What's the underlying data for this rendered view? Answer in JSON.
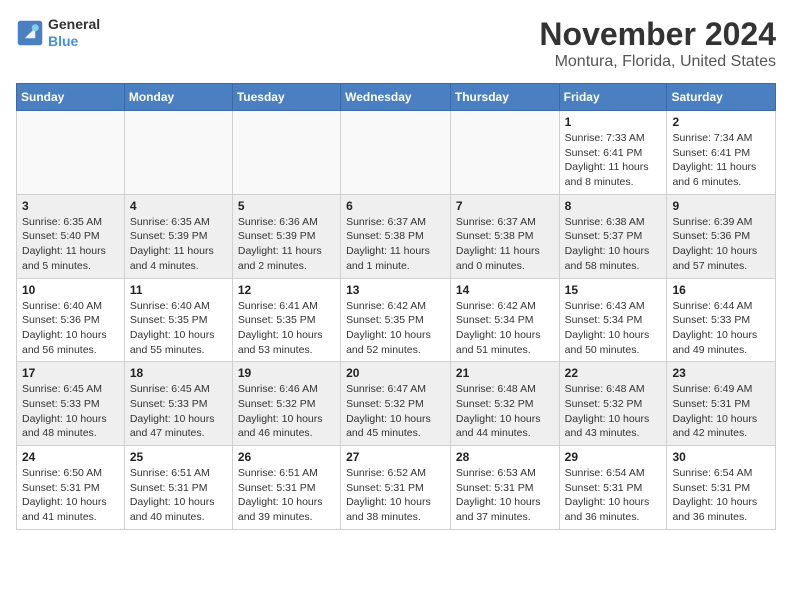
{
  "app": {
    "logo_line1": "General",
    "logo_line2": "Blue"
  },
  "title": "November 2024",
  "subtitle": "Montura, Florida, United States",
  "weekdays": [
    "Sunday",
    "Monday",
    "Tuesday",
    "Wednesday",
    "Thursday",
    "Friday",
    "Saturday"
  ],
  "weeks": [
    [
      {
        "day": "",
        "info": ""
      },
      {
        "day": "",
        "info": ""
      },
      {
        "day": "",
        "info": ""
      },
      {
        "day": "",
        "info": ""
      },
      {
        "day": "",
        "info": ""
      },
      {
        "day": "1",
        "info": "Sunrise: 7:33 AM\nSunset: 6:41 PM\nDaylight: 11 hours\nand 8 minutes."
      },
      {
        "day": "2",
        "info": "Sunrise: 7:34 AM\nSunset: 6:41 PM\nDaylight: 11 hours\nand 6 minutes."
      }
    ],
    [
      {
        "day": "3",
        "info": "Sunrise: 6:35 AM\nSunset: 5:40 PM\nDaylight: 11 hours\nand 5 minutes."
      },
      {
        "day": "4",
        "info": "Sunrise: 6:35 AM\nSunset: 5:39 PM\nDaylight: 11 hours\nand 4 minutes."
      },
      {
        "day": "5",
        "info": "Sunrise: 6:36 AM\nSunset: 5:39 PM\nDaylight: 11 hours\nand 2 minutes."
      },
      {
        "day": "6",
        "info": "Sunrise: 6:37 AM\nSunset: 5:38 PM\nDaylight: 11 hours\nand 1 minute."
      },
      {
        "day": "7",
        "info": "Sunrise: 6:37 AM\nSunset: 5:38 PM\nDaylight: 11 hours\nand 0 minutes."
      },
      {
        "day": "8",
        "info": "Sunrise: 6:38 AM\nSunset: 5:37 PM\nDaylight: 10 hours\nand 58 minutes."
      },
      {
        "day": "9",
        "info": "Sunrise: 6:39 AM\nSunset: 5:36 PM\nDaylight: 10 hours\nand 57 minutes."
      }
    ],
    [
      {
        "day": "10",
        "info": "Sunrise: 6:40 AM\nSunset: 5:36 PM\nDaylight: 10 hours\nand 56 minutes."
      },
      {
        "day": "11",
        "info": "Sunrise: 6:40 AM\nSunset: 5:35 PM\nDaylight: 10 hours\nand 55 minutes."
      },
      {
        "day": "12",
        "info": "Sunrise: 6:41 AM\nSunset: 5:35 PM\nDaylight: 10 hours\nand 53 minutes."
      },
      {
        "day": "13",
        "info": "Sunrise: 6:42 AM\nSunset: 5:35 PM\nDaylight: 10 hours\nand 52 minutes."
      },
      {
        "day": "14",
        "info": "Sunrise: 6:42 AM\nSunset: 5:34 PM\nDaylight: 10 hours\nand 51 minutes."
      },
      {
        "day": "15",
        "info": "Sunrise: 6:43 AM\nSunset: 5:34 PM\nDaylight: 10 hours\nand 50 minutes."
      },
      {
        "day": "16",
        "info": "Sunrise: 6:44 AM\nSunset: 5:33 PM\nDaylight: 10 hours\nand 49 minutes."
      }
    ],
    [
      {
        "day": "17",
        "info": "Sunrise: 6:45 AM\nSunset: 5:33 PM\nDaylight: 10 hours\nand 48 minutes."
      },
      {
        "day": "18",
        "info": "Sunrise: 6:45 AM\nSunset: 5:33 PM\nDaylight: 10 hours\nand 47 minutes."
      },
      {
        "day": "19",
        "info": "Sunrise: 6:46 AM\nSunset: 5:32 PM\nDaylight: 10 hours\nand 46 minutes."
      },
      {
        "day": "20",
        "info": "Sunrise: 6:47 AM\nSunset: 5:32 PM\nDaylight: 10 hours\nand 45 minutes."
      },
      {
        "day": "21",
        "info": "Sunrise: 6:48 AM\nSunset: 5:32 PM\nDaylight: 10 hours\nand 44 minutes."
      },
      {
        "day": "22",
        "info": "Sunrise: 6:48 AM\nSunset: 5:32 PM\nDaylight: 10 hours\nand 43 minutes."
      },
      {
        "day": "23",
        "info": "Sunrise: 6:49 AM\nSunset: 5:31 PM\nDaylight: 10 hours\nand 42 minutes."
      }
    ],
    [
      {
        "day": "24",
        "info": "Sunrise: 6:50 AM\nSunset: 5:31 PM\nDaylight: 10 hours\nand 41 minutes."
      },
      {
        "day": "25",
        "info": "Sunrise: 6:51 AM\nSunset: 5:31 PM\nDaylight: 10 hours\nand 40 minutes."
      },
      {
        "day": "26",
        "info": "Sunrise: 6:51 AM\nSunset: 5:31 PM\nDaylight: 10 hours\nand 39 minutes."
      },
      {
        "day": "27",
        "info": "Sunrise: 6:52 AM\nSunset: 5:31 PM\nDaylight: 10 hours\nand 38 minutes."
      },
      {
        "day": "28",
        "info": "Sunrise: 6:53 AM\nSunset: 5:31 PM\nDaylight: 10 hours\nand 37 minutes."
      },
      {
        "day": "29",
        "info": "Sunrise: 6:54 AM\nSunset: 5:31 PM\nDaylight: 10 hours\nand 36 minutes."
      },
      {
        "day": "30",
        "info": "Sunrise: 6:54 AM\nSunset: 5:31 PM\nDaylight: 10 hours\nand 36 minutes."
      }
    ]
  ]
}
